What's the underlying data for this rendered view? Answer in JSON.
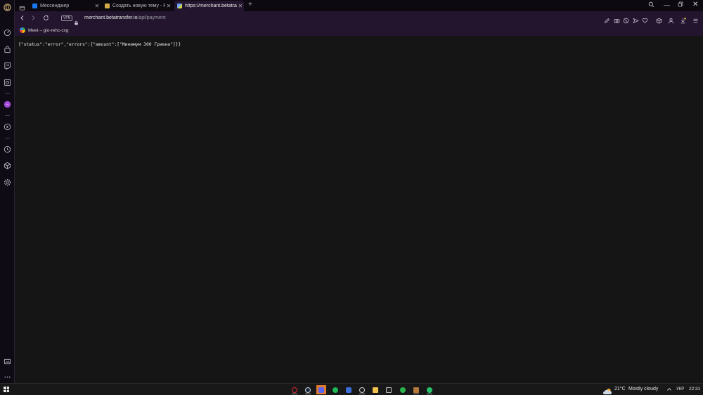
{
  "tabs": [
    {
      "title": "Мессенджер",
      "favicon_color": "#1877f2"
    },
    {
      "title": "Создать новую тему - Re",
      "favicon_color": "#d4a94a"
    },
    {
      "title": "https://merchant.betatrans",
      "favicon_color": "#a8c64a"
    }
  ],
  "address": {
    "vpn_label": "VPN",
    "url_host": "merchant.betatransfer.io",
    "url_path": "/api/payment"
  },
  "bookmarks": [
    {
      "label": "Meet – gio-rehc-cxg"
    }
  ],
  "page": {
    "json_text": "{\"status\":\"error\",\"errors\":{\"amount\":[\"Минимум 300 Гривна\"]}}"
  },
  "taskbar": {
    "weather_temp": "21°C",
    "weather_desc": "Mostly cloudy",
    "language": "УКР",
    "time": "22:31"
  },
  "colors": {
    "accent": "#24152f",
    "taskbar_active": "#e07a2c"
  }
}
